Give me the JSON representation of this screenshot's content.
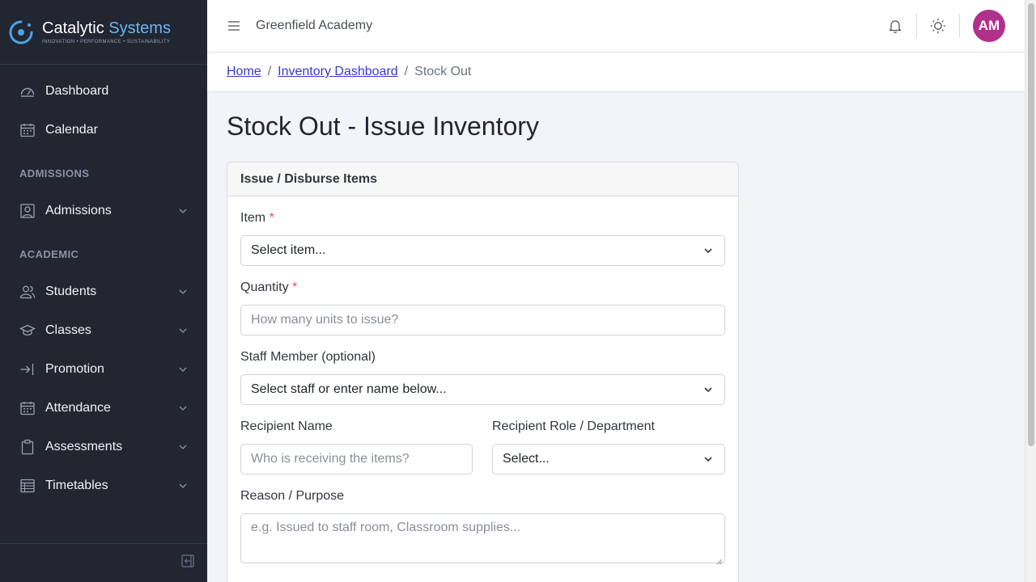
{
  "brand": {
    "word1": "Catalytic",
    "word2": "Systems",
    "tagline": "INNOVATION • PERFORMANCE • SUSTAINABILITY",
    "accent": "#4aa3e8"
  },
  "sidebar": {
    "items": [
      {
        "label": "Dashboard",
        "icon": "speedometer-icon"
      },
      {
        "label": "Calendar",
        "icon": "calendar-icon"
      },
      {
        "section": "ADMISSIONS"
      },
      {
        "label": "Admissions",
        "icon": "user-square-icon",
        "expandable": true
      },
      {
        "section": "ACADEMIC"
      },
      {
        "label": "Students",
        "icon": "people-icon",
        "expandable": true
      },
      {
        "label": "Classes",
        "icon": "education-icon",
        "expandable": true
      },
      {
        "label": "Promotion",
        "icon": "arrow-into-icon",
        "expandable": true
      },
      {
        "label": "Attendance",
        "icon": "calendar-icon",
        "expandable": true
      },
      {
        "label": "Assessments",
        "icon": "clipboard-icon",
        "expandable": true
      },
      {
        "label": "Timetables",
        "icon": "table-icon",
        "expandable": true
      }
    ],
    "bg": "#212631"
  },
  "header": {
    "school": "Greenfield Academy",
    "avatar_initials": "AM",
    "avatar_color": "#b0318c"
  },
  "breadcrumb": {
    "home": "Home",
    "dashboard": "Inventory Dashboard",
    "current": "Stock Out",
    "sep": "/"
  },
  "main": {
    "title": "Stock Out - Issue Inventory",
    "card_title": "Issue / Disburse Items",
    "form": {
      "item_label": "Item",
      "item_value": "Select item...",
      "quantity_label": "Quantity",
      "quantity_placeholder": "How many units to issue?",
      "staff_label": "Staff Member (optional)",
      "staff_value": "Select staff or enter name below...",
      "recipient_label": "Recipient Name",
      "recipient_placeholder": "Who is receiving the items?",
      "role_label": "Recipient Role / Department",
      "role_value": "Select...",
      "reason_label": "Reason / Purpose",
      "reason_placeholder": "e.g. Issued to staff room, Classroom supplies...",
      "required_mark": "*"
    }
  }
}
